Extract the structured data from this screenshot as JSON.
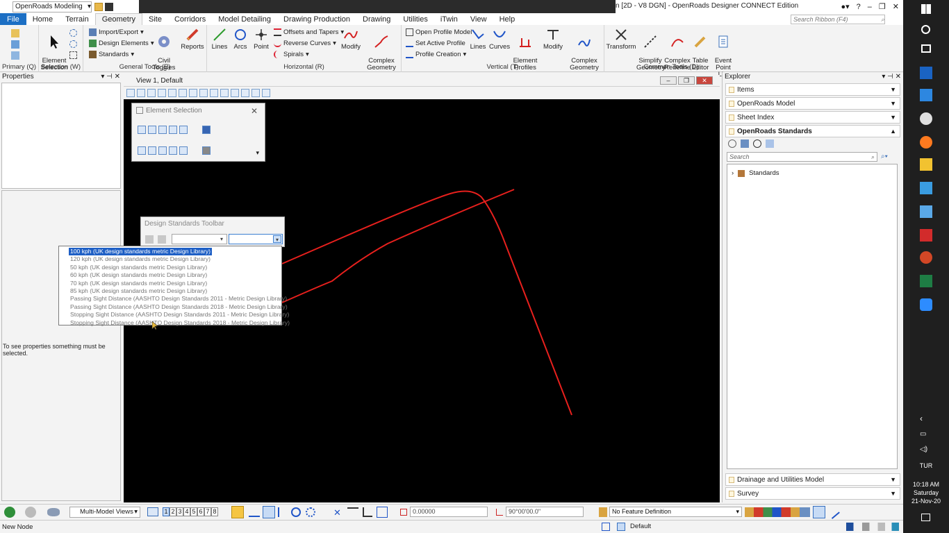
{
  "titlebar": {
    "workflow": "OpenRoads Modeling",
    "title": "n [2D - V8 DGN] - OpenRoads Designer CONNECT Edition"
  },
  "tabs": [
    "File",
    "Home",
    "Terrain",
    "Geometry",
    "Site",
    "Corridors",
    "Model Detailing",
    "Drawing Production",
    "Drawing",
    "Utilities",
    "iTwin",
    "View",
    "Help"
  ],
  "ribbon_search_placeholder": "Search Ribbon (F4)",
  "ribbon": {
    "primary_label": "Primary (Q)",
    "element_selection": "Element\nSelection",
    "selection_label": "Selection (W)",
    "import_export": "Import/Export",
    "design_elements": "Design Elements",
    "standards": "Standards",
    "civil_toggles": "Civil\nToggles",
    "reports": "Reports",
    "general_label": "General Tools (E)",
    "lines": "Lines",
    "arcs": "Arcs",
    "point": "Point",
    "offsets_tapers": "Offsets and Tapers",
    "reverse_curves": "Reverse Curves",
    "spirals": "Spirals",
    "modify": "Modify",
    "complex_geometry": "Complex\nGeometry",
    "horizontal_label": "Horizontal (R)",
    "open_profile_model": "Open Profile Model",
    "set_active_profile": "Set Active Profile",
    "profile_creation": "Profile Creation",
    "v_lines": "Lines",
    "v_curves": "Curves",
    "element_profiles": "Element\nProfiles",
    "v_modify": "Modify",
    "v_complex_geometry": "Complex\nGeometry",
    "vertical_label": "Vertical (T)",
    "transform": "Transform",
    "simplify_geometry": "Simplify\nGeometry",
    "complex_redefine": "Complex\nRedefine",
    "table_editor": "Table\nEditor",
    "event_point_list": "Event\nPoint List",
    "common_label": "Common Tools (D)"
  },
  "properties": {
    "title": "Properties",
    "message": "To see properties something must be selected."
  },
  "view": {
    "title": "View 1, Default"
  },
  "element_selection": {
    "title": "Element Selection"
  },
  "design_standards": {
    "title": "Design Standards Toolbar",
    "options": [
      "100 kph (UK design standards metric Design Library)",
      "120 kph (UK design standards metric Design Library)",
      "50 kph (UK design standards metric Design Library)",
      "60 kph (UK design standards metric Design Library)",
      "70 kph (UK design standards metric Design Library)",
      "85 kph (UK design standards metric Design Library)",
      "Passing Sight Distance (AASHTO Design Standards 2011 - Metric Design Library)",
      "Passing Sight Distance (AASHTO Design Standards 2018 - Metric Design Library)",
      "Stopping Sight Distance (AASHTO Design Standards 2011 - Metric Design Library)",
      "Stopping Sight Distance (AASHTO Design Standards 2018 - Metric Design Library)"
    ]
  },
  "explorer": {
    "title": "Explorer",
    "items": [
      "Items",
      "OpenRoads Model",
      "Sheet Index",
      "OpenRoads Standards"
    ],
    "search_placeholder": "Search",
    "tree_root": "Standards",
    "bottom_items": [
      "Drainage and Utilities Model",
      "Survey"
    ]
  },
  "bottom": {
    "model_views": "Multi-Model Views",
    "view_numbers": [
      "1",
      "2",
      "3",
      "4",
      "5",
      "6",
      "7",
      "8"
    ],
    "distance": "0.00000",
    "angle": "90°00'00.0\"",
    "feature_definition": "No Feature Definition"
  },
  "status": {
    "left": "New Node",
    "level": "Default"
  },
  "taskbar": {
    "lang": "TUR",
    "time": "10:18 AM",
    "day": "Saturday",
    "date": "21-Nov-20"
  },
  "colors": {
    "accent": "#1c6fc4",
    "highlight": "#1e5fc5",
    "geometry": "#e8201d"
  }
}
